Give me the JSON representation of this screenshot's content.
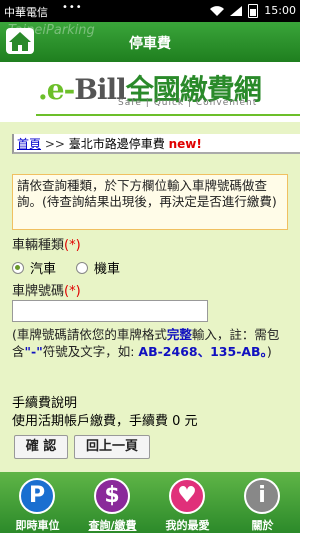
{
  "status_bar": {
    "carrier": "中華電信",
    "dots": "•••",
    "time": "15:00"
  },
  "header": {
    "watermark": "TaipeiParking",
    "title": "停車費"
  },
  "banner": {
    "logo_prefix": ".e-",
    "logo_bill": "Bill",
    "logo_cn": "全國繳費網",
    "tagline": "Safe | Quick | Convenient"
  },
  "breadcrumb": {
    "home": "首頁",
    "separator": ">>",
    "current": "臺北市路邊停車費",
    "badge": "new!"
  },
  "notice": "請依查詢種類，於下方欄位輸入車牌號碼做查詢。(待查詢結果出現後，再決定是否進行繳費)",
  "form": {
    "vehicle_type_label": "車輛種類",
    "required_mark": "(*)",
    "vehicle_options": [
      "汽車",
      "機車"
    ],
    "selected_vehicle": "汽車",
    "plate_label": "車牌號碼",
    "plate_value": "",
    "hint_prefix": "(車牌號碼請依您的車牌格式",
    "hint_complete": "完整",
    "hint_middle": "輸入，註：需包含",
    "hint_dash": "\"-\"",
    "hint_middle2": "符號及文字，如: ",
    "hint_example": "AB-2468、135-AB。",
    "hint_close": ")",
    "fee_title": "手續費說明",
    "fee_text": "使用活期帳戶繳費，手續費 0 元",
    "confirm_label": "確 認",
    "back_label": "回上一頁"
  },
  "bottom_nav": {
    "items": [
      {
        "label": "即時車位",
        "glyph": "P",
        "color": "#1a6fd0"
      },
      {
        "label": "查詢/繳費",
        "glyph": "$",
        "color": "#8a2a9a"
      },
      {
        "label": "我的最愛",
        "glyph": "♥",
        "color": "#e0307a"
      },
      {
        "label": "關於",
        "glyph": "i",
        "color": "#888888"
      }
    ],
    "active_index": 1
  }
}
